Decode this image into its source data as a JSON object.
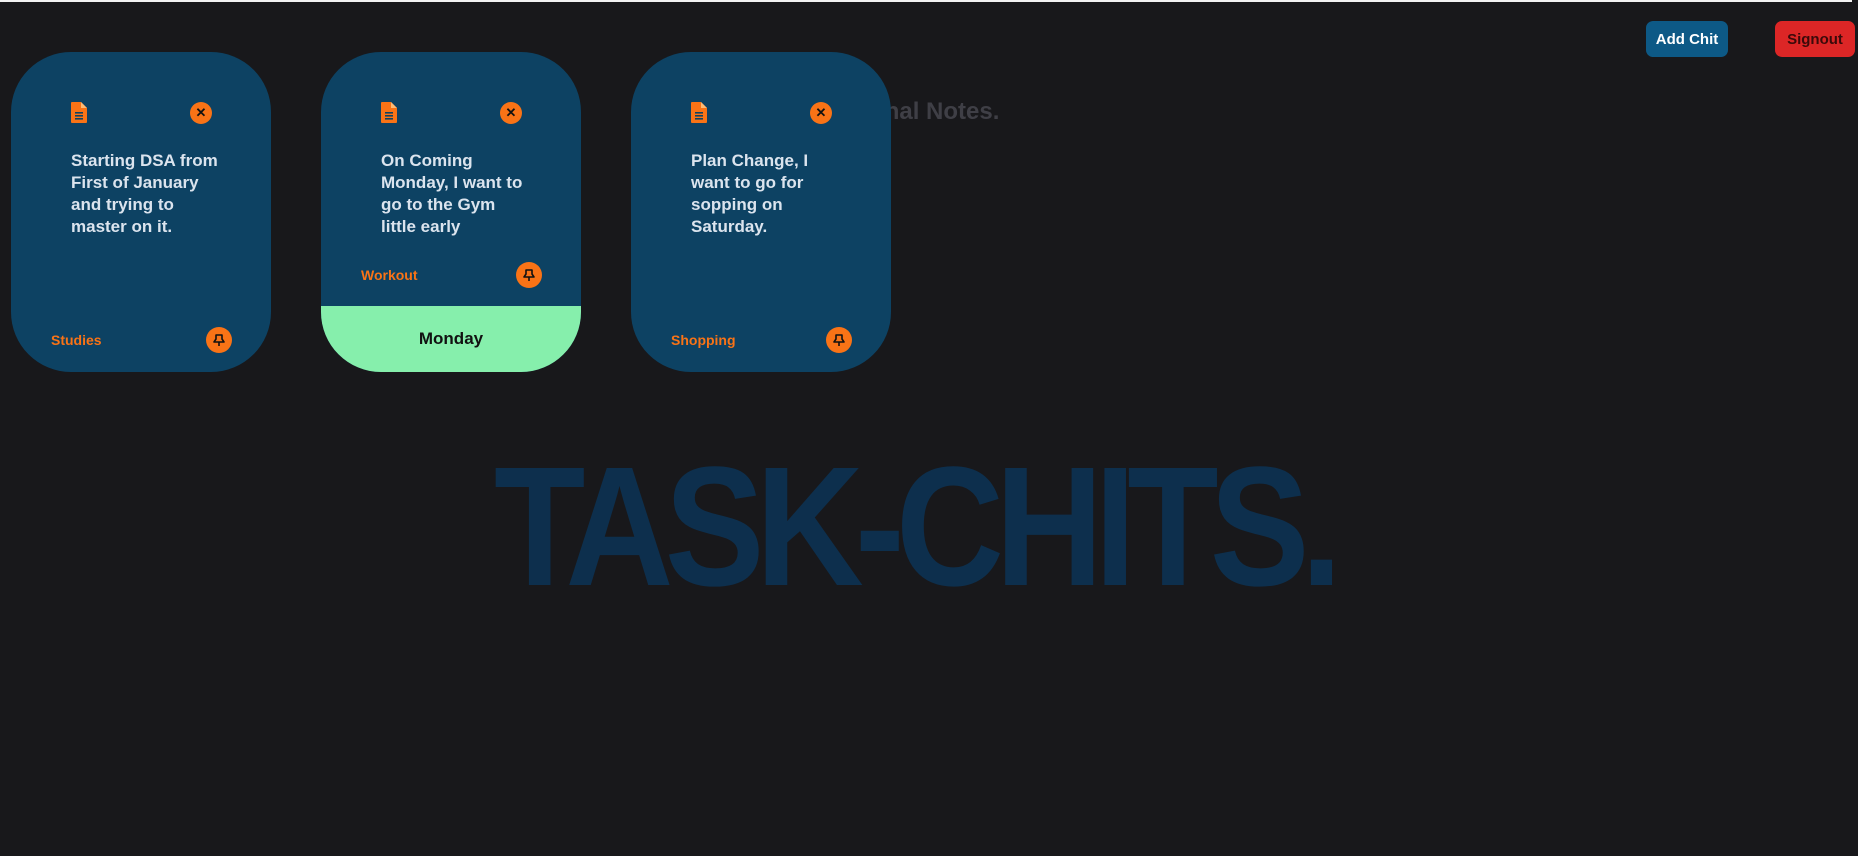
{
  "header": {
    "add_label": "Add Chit",
    "signout_label": "Signout"
  },
  "brand": {
    "bg_title": "TASK-CHITS.",
    "subtitle": "Personal Notes."
  },
  "colors": {
    "background": "#18181b",
    "card": "#0d4263",
    "accent": "#f97316",
    "add_button": "#0d5986",
    "signout_button": "#dc2626",
    "day_footer": "#86efac",
    "watermark": "#0d2f4d"
  },
  "chits": [
    {
      "text": "Starting DSA from First of January and trying to master on it.",
      "tag": "Studies",
      "day": null,
      "icons": [
        "document-icon",
        "close-icon",
        "pin-icon"
      ]
    },
    {
      "text": "On Coming Monday, I want to go to the Gym little early",
      "tag": "Workout",
      "day": "Monday",
      "icons": [
        "document-icon",
        "close-icon",
        "pin-icon"
      ]
    },
    {
      "text": "Plan Change, I want to go for sopping on Saturday.",
      "tag": "Shopping",
      "day": null,
      "icons": [
        "document-icon",
        "close-icon",
        "pin-icon"
      ]
    }
  ]
}
